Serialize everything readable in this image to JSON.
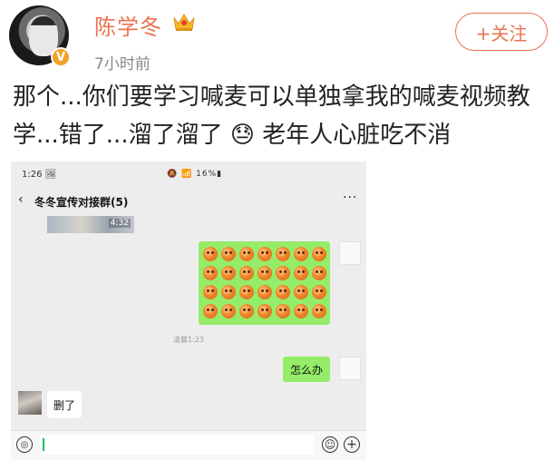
{
  "post": {
    "username": "陈学冬",
    "time": "7小时前",
    "follow_label": "+关注",
    "verified_badge": "V",
    "text": "那个...你们要学习喊麦可以单独拿我的喊麦视频教学...错了...溜了溜了 😓 老年人心脏吃不消"
  },
  "screenshot": {
    "status_time": "1:26 🖼",
    "status_right": "🔕 📶 16%▮",
    "chat_title": "冬冬宣传对接群(5)",
    "back_glyph": "‹",
    "more_glyph": "···",
    "video_duration": "4:32",
    "message_time": "凌晨1:23",
    "bubble_text": "怎么办",
    "left_bubble_text": "删了",
    "voice_glyph": "◎",
    "emoji_glyph": "☺",
    "plus_glyph": "+"
  },
  "colors": {
    "accent": "#eb7350",
    "chat_green": "#95ec69",
    "chat_bg": "#ededed"
  }
}
